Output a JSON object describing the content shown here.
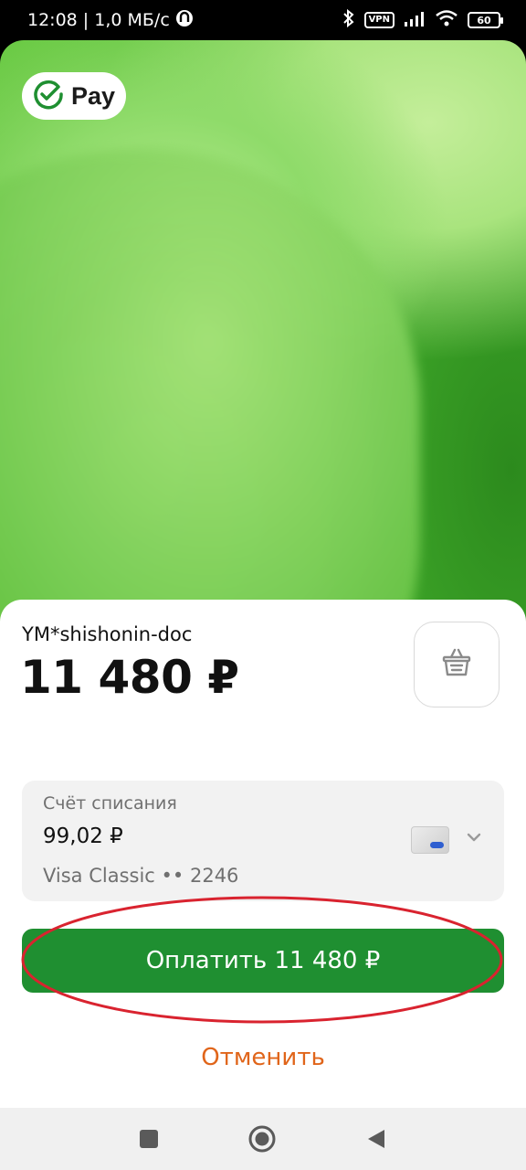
{
  "status_bar": {
    "time_speed": "12:08 | 1,0 МБ/с",
    "vpn": "VPN",
    "battery": "60"
  },
  "brand": {
    "label": "Pay",
    "color": "#1f8f31"
  },
  "payment": {
    "merchant": "YM*shishonin-doc",
    "amount": "11 480 ₽"
  },
  "account": {
    "title": "Счёт списания",
    "balance": "99,02 ₽",
    "card_name": "Visa Classic •• 2246"
  },
  "actions": {
    "pay_label": "Оплатить 11 480 ₽",
    "cancel_label": "Отменить",
    "cancel_color": "#e0651a"
  },
  "icons": [
    "sberpay-check-icon",
    "cart-icon",
    "card-icon",
    "chevron-down-icon",
    "bluetooth-icon",
    "signal-icon",
    "wifi-icon",
    "battery-icon"
  ]
}
